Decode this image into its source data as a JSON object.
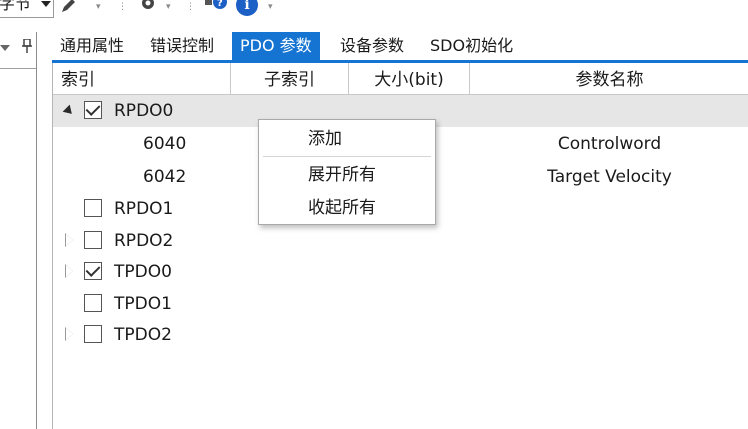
{
  "toolbar": {
    "combo_value": "字节",
    "icons": [
      "pencil-icon",
      "gear-icon",
      "help-icon",
      "info-icon"
    ],
    "info_glyph": "i"
  },
  "tabs": [
    {
      "label": "通用属性",
      "active": false
    },
    {
      "label": "错误控制",
      "active": false
    },
    {
      "label": "PDO 参数",
      "active": true
    },
    {
      "label": "设备参数",
      "active": false
    },
    {
      "label": "SDO初始化",
      "active": false
    }
  ],
  "grid": {
    "columns": [
      "索引",
      "子索引",
      "大小(bit)",
      "参数名称"
    ],
    "rows": [
      {
        "label": "RPDO0",
        "checked": true,
        "expander": "expanded",
        "selected": true
      },
      {
        "sub_index": "6040",
        "param_name": "Controlword"
      },
      {
        "sub_index": "6042",
        "param_name": "Target Velocity"
      },
      {
        "label": "RPDO1",
        "checked": false,
        "expander": "none"
      },
      {
        "label": "RPDO2",
        "checked": false,
        "expander": "collapsed"
      },
      {
        "label": "TPDO0",
        "checked": true,
        "expander": "collapsed"
      },
      {
        "label": "TPDO1",
        "checked": false,
        "expander": "none"
      },
      {
        "label": "TPDO2",
        "checked": false,
        "expander": "collapsed"
      }
    ]
  },
  "context_menu": {
    "items": [
      "添加",
      "展开所有",
      "收起所有"
    ]
  },
  "colors": {
    "accent": "#1574d1",
    "selected_row": "#e6e6e6"
  }
}
